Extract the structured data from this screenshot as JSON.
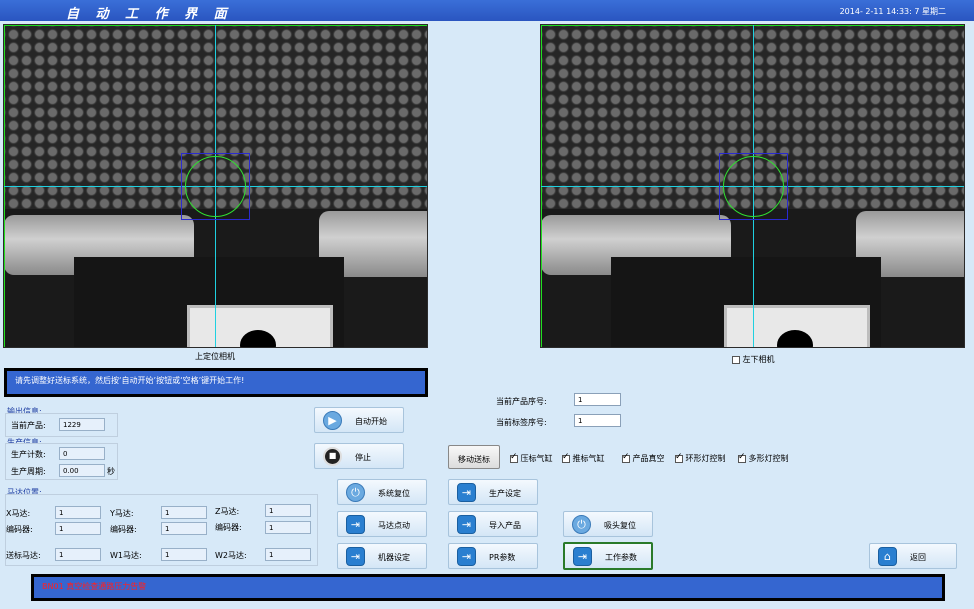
{
  "window": {
    "title": "自 动 工 作 界 面",
    "clock": "2014- 2-11  14:33: 7  星期二"
  },
  "cameras": {
    "left_label": "上定位相机",
    "right_label": "左下相机",
    "right_checked": false
  },
  "message_top": "请先调整好送标系统，然后按‘自动开始’按钮或‘空格’键开始工作!",
  "message_bottom": "BN01 真空检查通路压力告警",
  "output": {
    "title": "输出信息:",
    "current_product_label": "当前产品:",
    "current_product_value": "1229"
  },
  "production": {
    "title": "生产信息:",
    "count_label": "生产计数:",
    "count_value": "0",
    "period_label": "生产周期:",
    "period_value": "0.00",
    "period_unit": "秒"
  },
  "motors": {
    "title": "马达位置:",
    "x_label": "X马达:",
    "x_value": "1",
    "y_label": "Y马达:",
    "y_value": "1",
    "z_label": "Z马达:",
    "z_value": "1",
    "enc_label": "编码器:",
    "enc1": "1",
    "enc2": "1",
    "enc3": "1",
    "feed_label": "送标马达:",
    "feed_value": "1",
    "w1_label": "W1马达:",
    "w1_value": "1",
    "w2_label": "W2马达:",
    "w2_value": "1"
  },
  "serials": {
    "product_label": "当前产品序号:",
    "product_value": "1",
    "label_label": "当前标签序号:",
    "label_value": "1"
  },
  "buttons": {
    "auto_start": "自动开始",
    "stop": "停止",
    "move_label": "移动送标",
    "sys_reset": "系统复位",
    "prod_setup": "生产设定",
    "motor_jog": "马达点动",
    "import_product": "导入产品",
    "head_reset": "吸头复位",
    "machine_setup": "机器设定",
    "pr_params": "PR参数",
    "work_params": "工作参数",
    "back": "返回"
  },
  "options": [
    {
      "label": "压标气缸",
      "checked": true
    },
    {
      "label": "推标气缸",
      "checked": true
    },
    {
      "label": "产品真空",
      "checked": true
    },
    {
      "label": "环形灯控制",
      "checked": true
    },
    {
      "label": "多形灯控制",
      "checked": true
    }
  ],
  "colors": {
    "accent": "#3566d0",
    "background": "#d7e9f8",
    "crosshair": "#1fd0e0",
    "frame": "#20e020",
    "alarm": "#ff2020"
  }
}
